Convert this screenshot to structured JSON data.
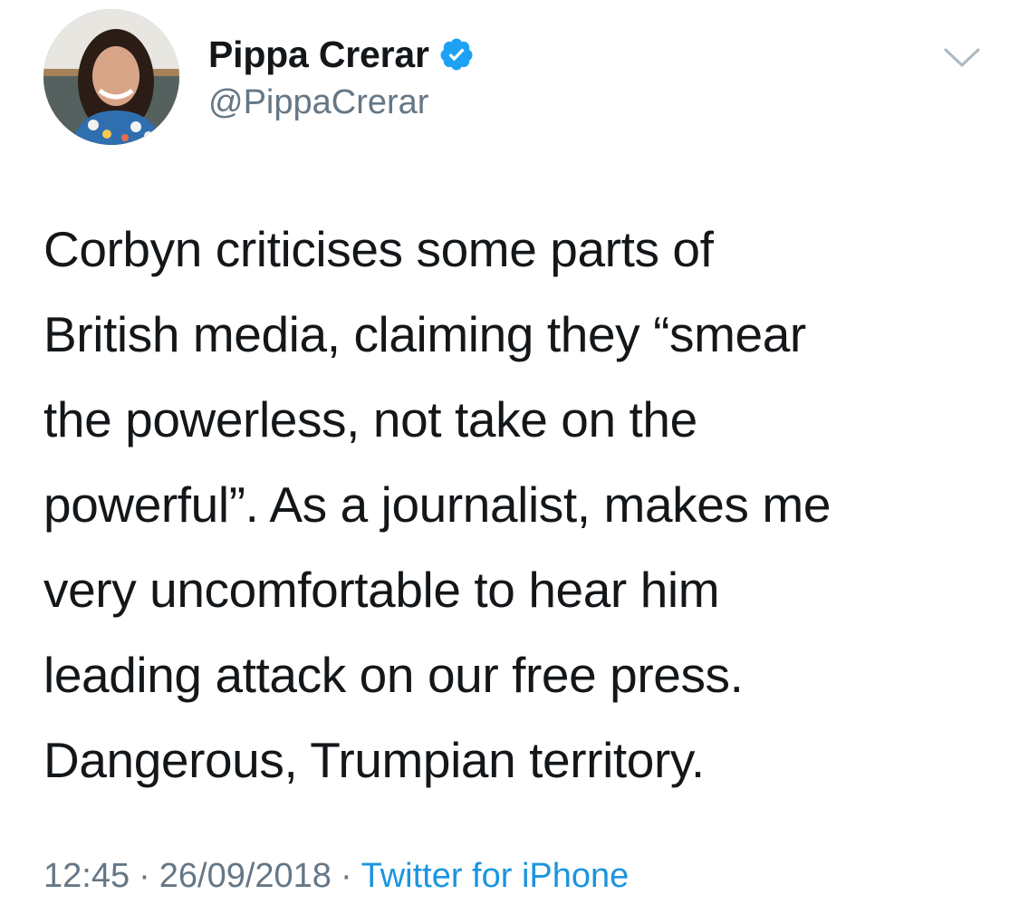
{
  "author": {
    "display_name": "Pippa Crerar",
    "handle": "@PippaCrerar",
    "verified": true,
    "avatar_icon": "profile-photo-avatar"
  },
  "tweet": {
    "text": "Corbyn criticises some parts of\nBritish media, claiming they “smear\nthe powerless, not take on the\npowerful”. As a journalist, makes me\nvery uncomfortable to hear him\nleading attack on our free press.\nDangerous, Trumpian territory.",
    "time": "12:45",
    "date": "26/09/2018",
    "separator": "·",
    "source": "Twitter for iPhone"
  },
  "icons": {
    "verified": "verified-badge-icon",
    "menu": "chevron-down-icon"
  },
  "colors": {
    "text": "#14171a",
    "secondary": "#657786",
    "link": "#1b95e0",
    "verified": "#1da1f2"
  }
}
